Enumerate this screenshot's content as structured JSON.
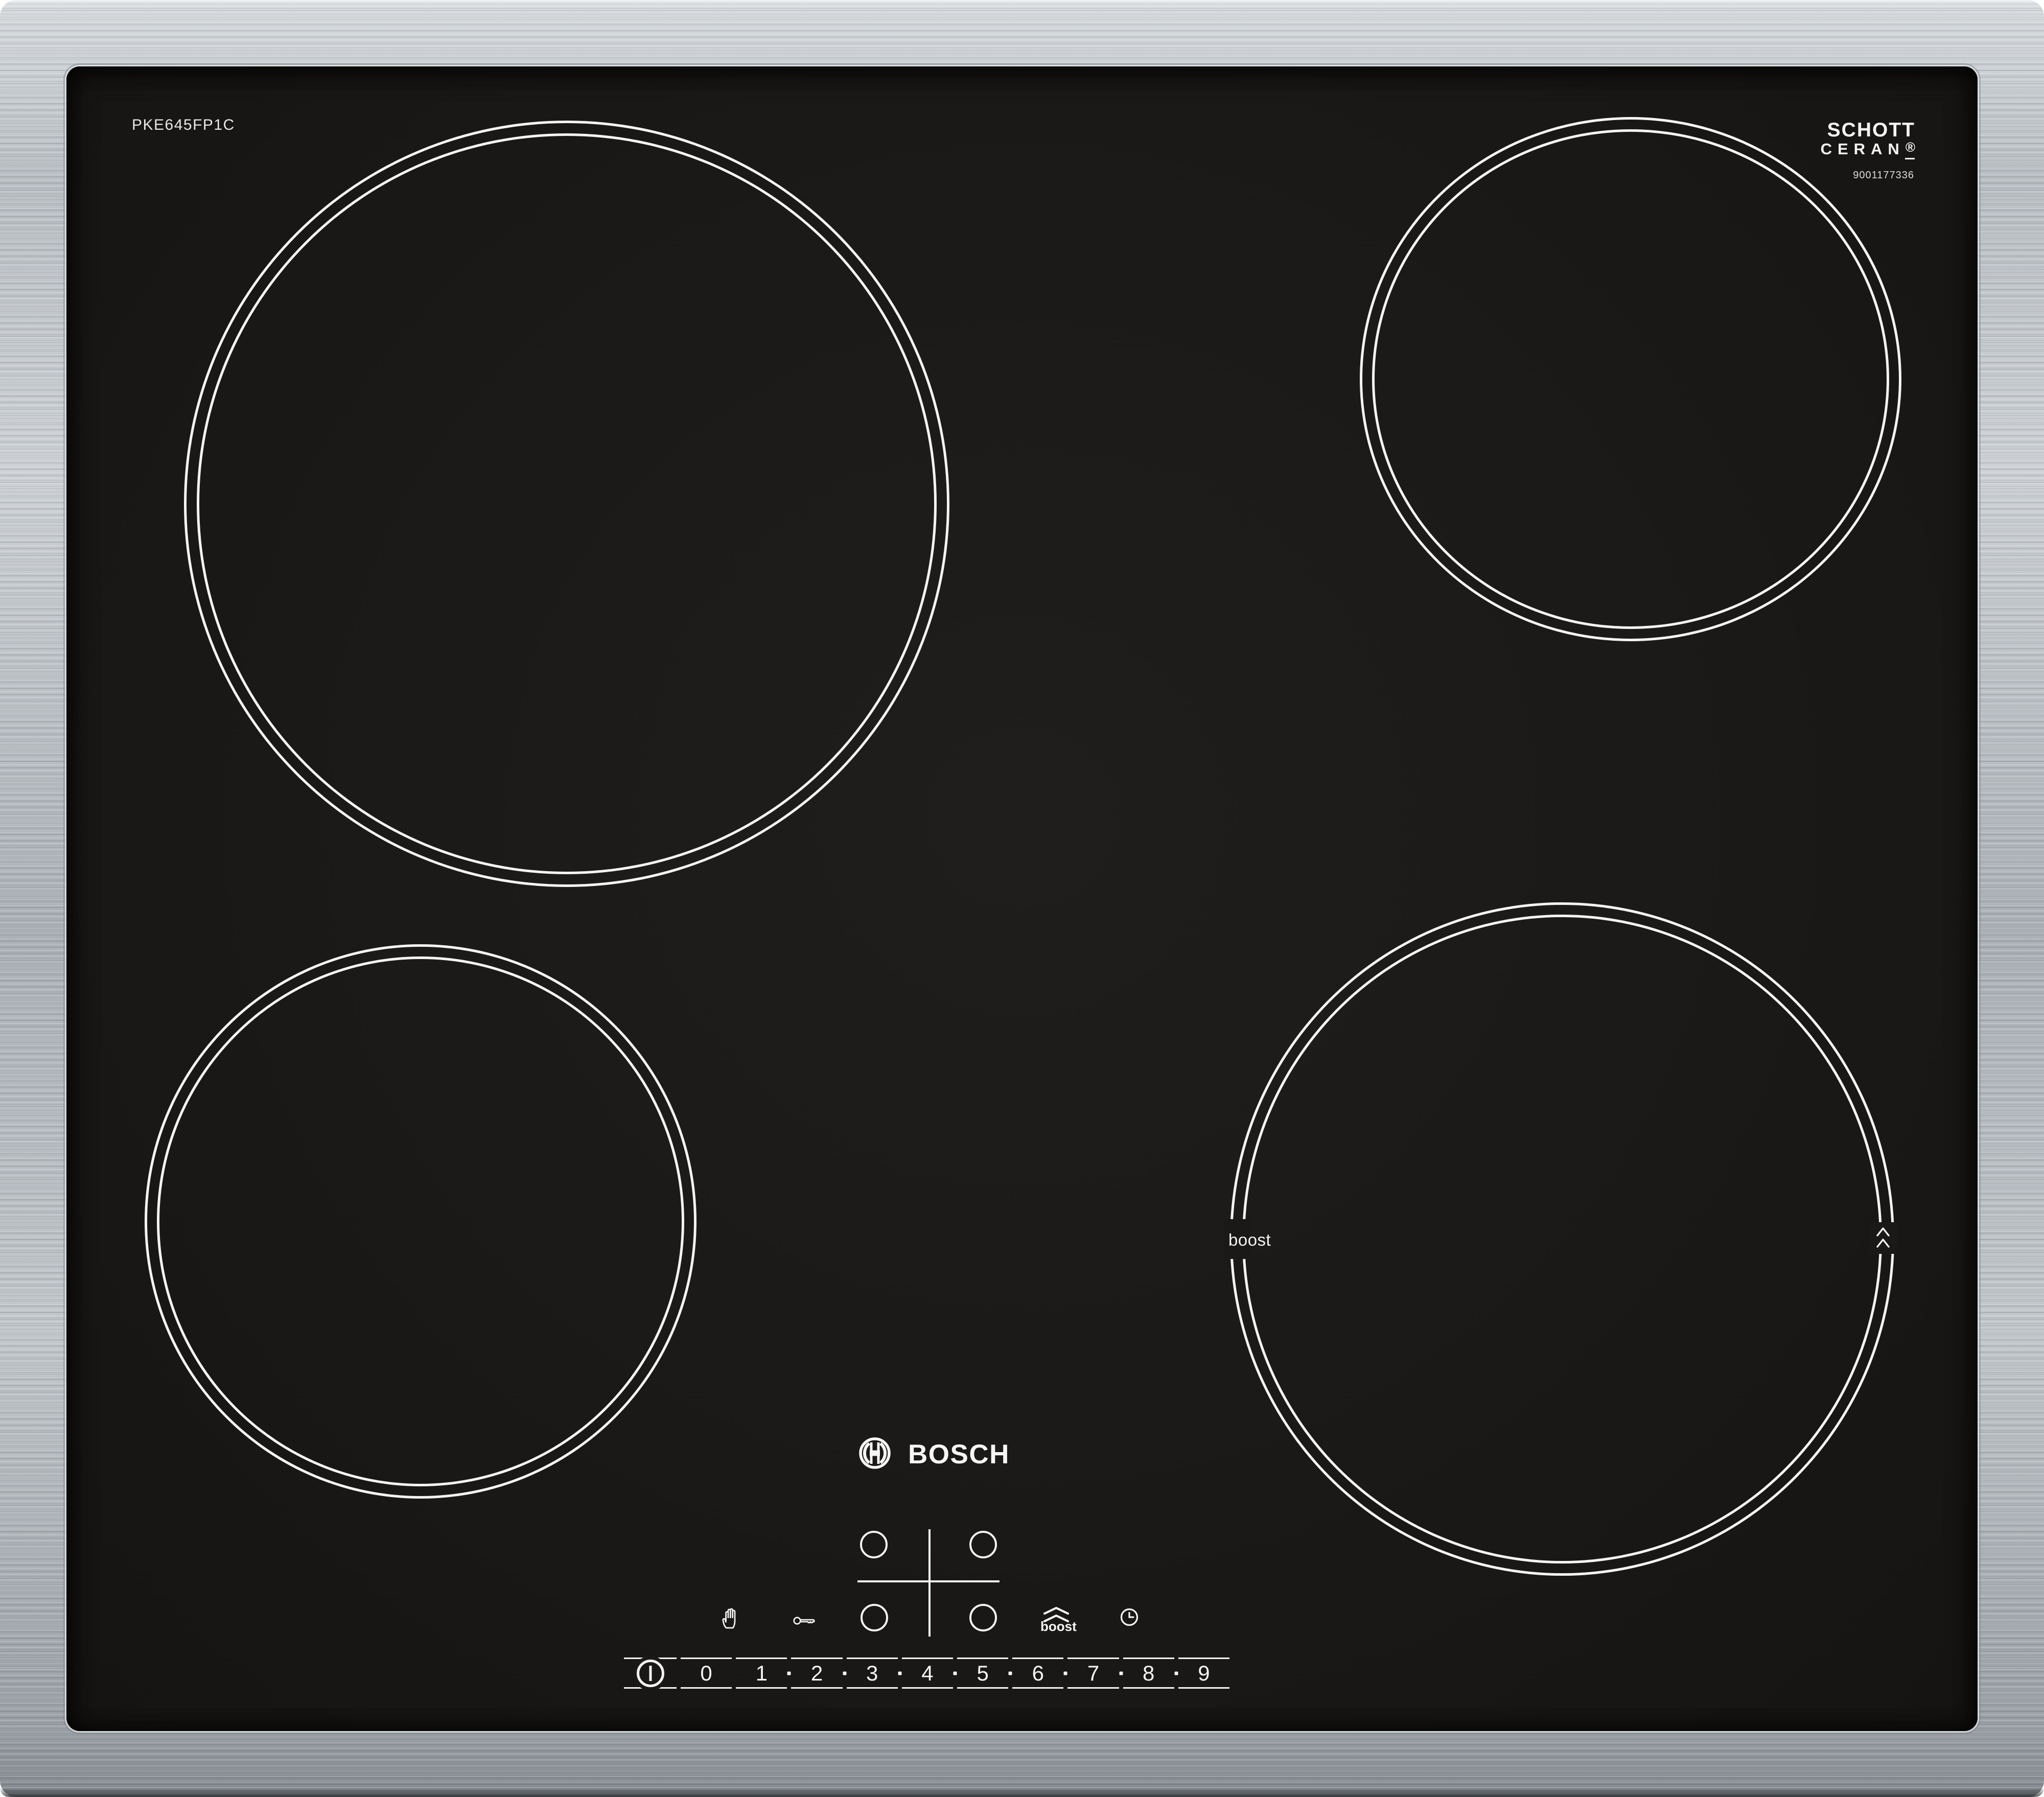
{
  "device": {
    "model_label": "PKE645FP1C",
    "serial_number": "9001177336"
  },
  "branding": {
    "bosch_logo_text": "BOSCH",
    "bosch_symbol_icon": "bosch-armature-icon",
    "glass_brand_line1": "SCHOTT",
    "glass_brand_line2": "CERAN",
    "registered_mark": "®"
  },
  "burners": {
    "front_right": {
      "boost_label": "boost",
      "boost_chevrons_icon": "chevron-double-up-icon"
    }
  },
  "control_panel": {
    "child_lock_icon": "hand-icon",
    "key_lock_icon": "key-icon",
    "boost": {
      "label": "boost",
      "icon": "chevron-double-up-icon"
    },
    "timer_icon": "clock-icon",
    "power": {
      "icon": "power-icon"
    },
    "zone_selector_icon": "zone-cross-icon",
    "slider": {
      "digits": [
        "0",
        "1",
        "2",
        "3",
        "4",
        "5",
        "6",
        "7",
        "8",
        "9"
      ]
    }
  },
  "colors": {
    "glass_black": "#1b1917",
    "markings_white": "#f4f4f2",
    "frame_metal": "#b7bcc1"
  }
}
